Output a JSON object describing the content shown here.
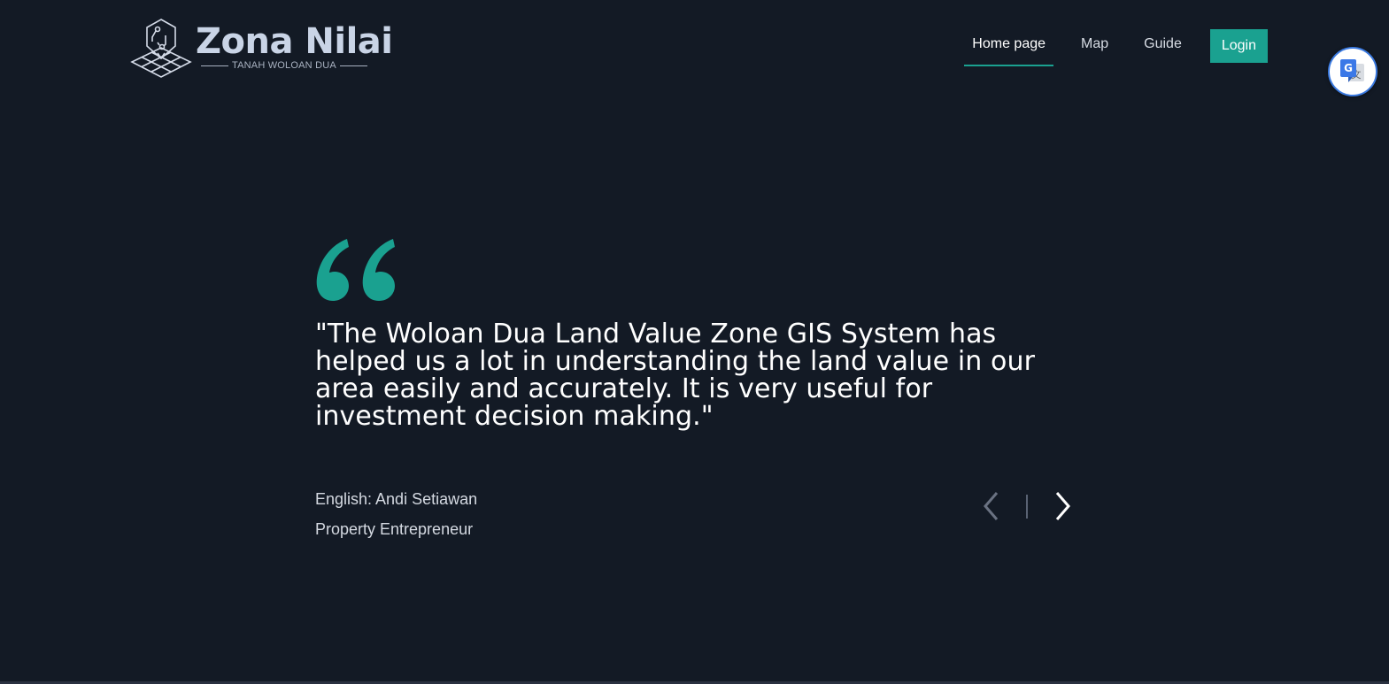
{
  "brand": {
    "title": "Zona Nilai",
    "subtitle": "TANAH WOLOAN DUA",
    "logo_icon": "map-pin-grid-icon"
  },
  "nav": {
    "items": [
      {
        "label": "Home page",
        "active": true
      },
      {
        "label": "Map",
        "active": false
      },
      {
        "label": "Guide",
        "active": false
      }
    ],
    "login_label": "Login"
  },
  "translate": {
    "icon": "google-translate-icon"
  },
  "testimonial": {
    "quote_icon": "quote-icon",
    "text": "\"The Woloan Dua Land Value Zone GIS System has helped us a lot in understanding the land value in our area easily and accurately. It is very useful for investment decision making.\"",
    "author": "English: Andi Setiawan",
    "role": "Property Entrepreneur",
    "prev_icon": "chevron-left-icon",
    "next_icon": "chevron-right-icon"
  },
  "colors": {
    "background": "#131a25",
    "accent": "#1aa190",
    "text": "#ffffff",
    "muted": "#d4d9e1"
  }
}
